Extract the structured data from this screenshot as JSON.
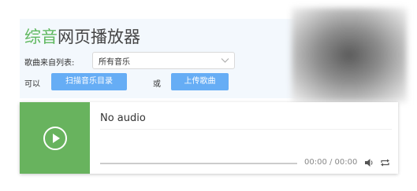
{
  "header": {
    "title_accent": "综音",
    "title_rest": "网页播放器"
  },
  "source": {
    "label": "歌曲来自列表:",
    "selected": "所有音乐"
  },
  "actions": {
    "prefix": "可以",
    "scan_label": "扫描音乐目录",
    "or": "或",
    "upload_label": "上传歌曲"
  },
  "player": {
    "track_title": "No audio",
    "time": "00:00 / 00:00",
    "progress": 0
  },
  "icons": {
    "play": "play-circle-icon",
    "volume": "volume-icon",
    "repeat": "repeat-icon",
    "select": "chevron-down-icon"
  },
  "colors": {
    "accent_green": "#5fb85f",
    "play_area": "#68b35e",
    "button_blue": "#66adf5",
    "panel_bg": "#f3f8fd"
  }
}
